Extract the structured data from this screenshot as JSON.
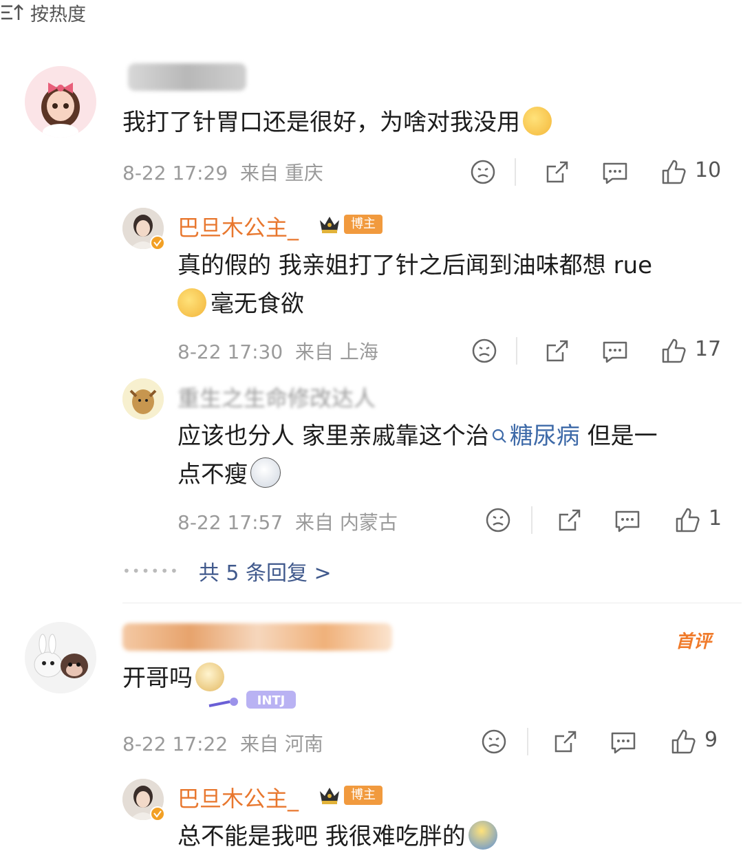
{
  "sort": {
    "label": "按热度"
  },
  "comments": [
    {
      "text": "我打了针胃口还是很好，为啥对我没用",
      "date": "8-22 17:29",
      "location": "来自 重庆",
      "likes": "10",
      "replies": [
        {
          "author": "巴旦木公主_",
          "badge": "博主",
          "text_line1": "真的假的 我亲姐打了针之后闻到油味都想 rue",
          "text_line2": "毫无食欲",
          "date": "8-22 17:30",
          "location": "来自 上海",
          "likes": "17"
        },
        {
          "author": "重生之生命修改达人",
          "text_pre": "应该也分人 家里亲戚靠这个治",
          "topic": "糖尿病",
          "text_post": " 但是一",
          "text_line2": "点不瘦",
          "date": "8-22 17:57",
          "location": "来自 内蒙古",
          "likes": "1"
        }
      ],
      "more_replies": "共 5 条回复 >"
    },
    {
      "tag": "首评",
      "text": "开哥吗",
      "date": "8-22 17:22",
      "location": "来自 河南",
      "likes": "9",
      "replies": [
        {
          "author": "巴旦木公主_",
          "badge": "博主",
          "text": "总不能是我吧 我很难吃胖的"
        }
      ]
    }
  ],
  "colors": {
    "accent_orange": "#e8772e",
    "link_blue": "#3e6aa8",
    "meta_gray": "#9a9a9a"
  }
}
